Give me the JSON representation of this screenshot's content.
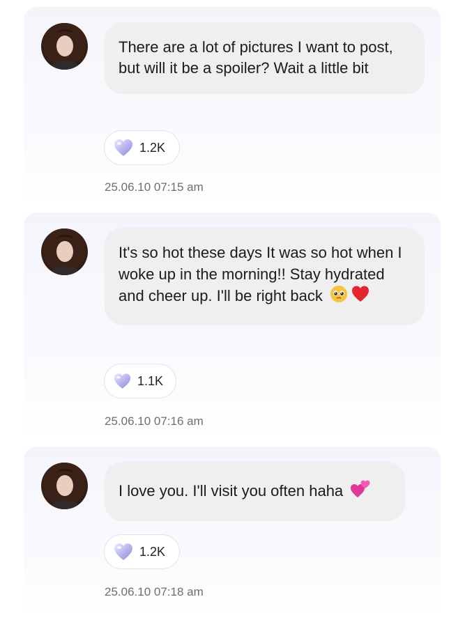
{
  "posts": [
    {
      "text": "There are a lot of pictures I want to post, but will it be a spoiler? Wait a little bit",
      "likes": "1.2K",
      "timestamp": "25.06.10 07:15 am"
    },
    {
      "text": "It's so hot these days It was so hot when I woke up in the morning!! Stay hydrated and cheer up. I'll be right back",
      "emojis": [
        "pleading-face",
        "red-heart"
      ],
      "likes": "1.1K",
      "timestamp": "25.06.10 07:16 am"
    },
    {
      "text": "I love you. I'll visit you often haha",
      "emojis": [
        "two-hearts"
      ],
      "likes": "1.2K",
      "timestamp": "25.06.10 07:18 am"
    }
  ],
  "colors": {
    "card_bg": "#f4f4fb",
    "bubble_bg": "#efefef",
    "text": "#1b1b1b",
    "timestamp": "#6e6e73",
    "heart": "#b9b7ee"
  }
}
